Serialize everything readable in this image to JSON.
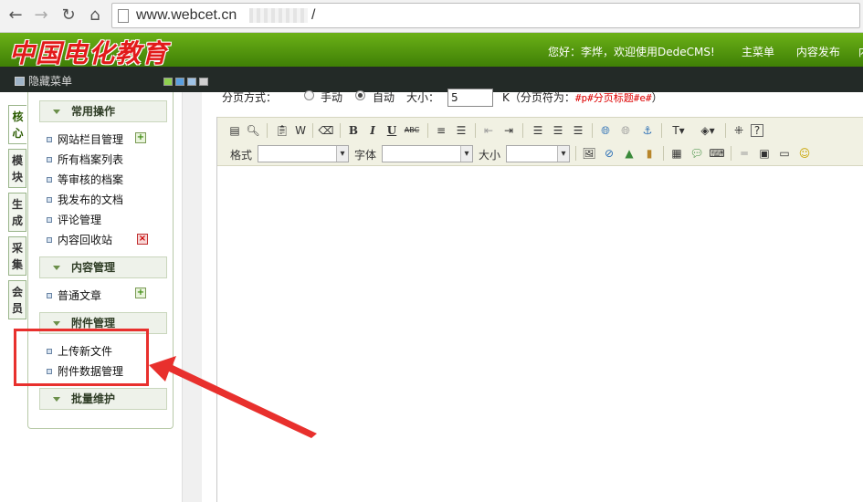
{
  "browser": {
    "url": "www.webcet.cn",
    "url_tail": "/"
  },
  "header": {
    "logo_text": "中国电化教育",
    "welcome": "您好：李烨，欢迎使用DedeCMS!",
    "menu": [
      "主菜单",
      "内容发布",
      "内"
    ]
  },
  "toolbar": {
    "hide_menu": "隐藏菜单",
    "skin_colors": [
      "#8fd14f",
      "#5aa0e0",
      "#9fc3e6",
      "#d0d0d0"
    ]
  },
  "vtabs": [
    {
      "label": "核心",
      "active": true
    },
    {
      "label": "模块",
      "active": false
    },
    {
      "label": "生成",
      "active": false
    },
    {
      "label": "采集",
      "active": false
    },
    {
      "label": "会员",
      "active": false
    }
  ],
  "sidebar": {
    "sections": [
      {
        "title": "常用操作",
        "items": [
          "网站栏目管理",
          "所有档案列表",
          "等审核的档案",
          "我发布的文档",
          "评论管理",
          "内容回收站"
        ]
      },
      {
        "title": "内容管理",
        "items": [
          "普通文章"
        ]
      },
      {
        "title": "附件管理",
        "items": [
          "上传新文件",
          "附件数据管理"
        ]
      },
      {
        "title": "批量维护",
        "items": []
      }
    ],
    "add_glyph": "+",
    "del_glyph": "×"
  },
  "pagination": {
    "label": "分页方式：",
    "manual": "手动",
    "auto": "自动",
    "size_label": "大小：",
    "size_value": "5",
    "hint_prefix": "K（分页符为：",
    "hint_code": "#p#分页标题#e#",
    "hint_suffix": "）"
  },
  "editor": {
    "format_label": "格式",
    "font_label": "字体",
    "size_label": "大小",
    "glyphs": {
      "bold": "B",
      "italic": "I",
      "underline": "U",
      "strike": "ABC",
      "help": "?",
      "smiley": "☺"
    }
  }
}
